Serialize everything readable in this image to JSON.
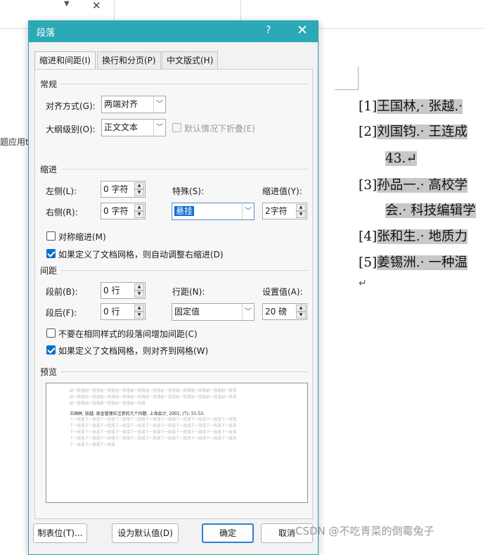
{
  "background": {
    "side_text": "题应用t",
    "references": [
      {
        "num": "[1]",
        "text": "王国林,· 张越.·"
      },
      {
        "num": "[2]",
        "text": "刘国钧.· 王连成"
      },
      {
        "num": "",
        "text": "43.↵"
      },
      {
        "num": "[3]",
        "text": "孙品一.· 高校学"
      },
      {
        "num": "",
        "text": "会.· 科技编辑学"
      },
      {
        "num": "[4]",
        "text": "张和生.· 地质力"
      },
      {
        "num": "[5]",
        "text": "姜锡洲.· 一种温"
      }
    ],
    "para_mark": "↵",
    "watermark": "CSDN @不吃青菜的倒霉兔子"
  },
  "dialog": {
    "title": "段落",
    "help": "?",
    "close": "✕",
    "tabs": [
      "缩进和间距(I)",
      "换行和分页(P)",
      "中文版式(H)"
    ],
    "general": {
      "section": "常规",
      "alignment_label": "对齐方式(G):",
      "alignment_value": "两端对齐",
      "outline_label": "大纲级别(O):",
      "outline_value": "正文文本",
      "collapse_label": "默认情况下折叠(E)"
    },
    "indent": {
      "section": "缩进",
      "left_label": "左侧(L):",
      "left_value": "0 字符",
      "right_label": "右侧(R):",
      "right_value": "0 字符",
      "special_label": "特殊(S):",
      "special_value": "悬挂",
      "by_label": "缩进值(Y):",
      "by_value": "2字符",
      "mirror_label": "对称缩进(M)",
      "auto_adjust_label": "如果定义了文档网格，则自动调整右缩进(D)"
    },
    "spacing": {
      "section": "间距",
      "before_label": "段前(B):",
      "before_value": "0 行",
      "after_label": "段后(F):",
      "after_value": "0 行",
      "line_label": "行距(N):",
      "line_value": "固定值",
      "at_label": "设置值(A):",
      "at_value": "20 磅",
      "no_space_label": "不要在相同样式的段落间增加间距(C)",
      "snap_grid_label": "如果定义了文档网格，则对齐到网格(W)"
    },
    "preview": {
      "section": "预览",
      "prev_lines": [
        "前一段落前一段落前一段落前一段落前一段落前一段落前一段落前一段落前一段落前一段落前一段落",
        "前一段落前一段落前一段落前一段落前一段落前一段落前一段落前一段落前一段落前一段落前一段落",
        "前一段落前一段落前一段落前一段落前一段落"
      ],
      "main_line": "王国林, 张越. 现金管理应注意的几个问题. 上海会计, 2002, (7): 51-53.",
      "next_lines": [
        "下一段落下一段落下一段落下一段落下一段落下一段落下一段落下一段落下一段落下一段落下一段落",
        "下一段落下一段落下一段落下一段落下一段落下一段落下一段落下一段落下一段落下一段落下一段落",
        "下一段落下一段落下一段落下一段落下一段落下一段落下一段落下一段落下一段落下一段落下一段落",
        "下一段落下一段落下一段落下一段落下一段落下一段落下一段落下一段落下一段落下一段落下一段落",
        "下一段落下一段落下一段落"
      ]
    },
    "buttons": {
      "tabs": "制表位(T)...",
      "default": "设为默认值(D)",
      "ok": "确定",
      "cancel": "取消"
    }
  }
}
